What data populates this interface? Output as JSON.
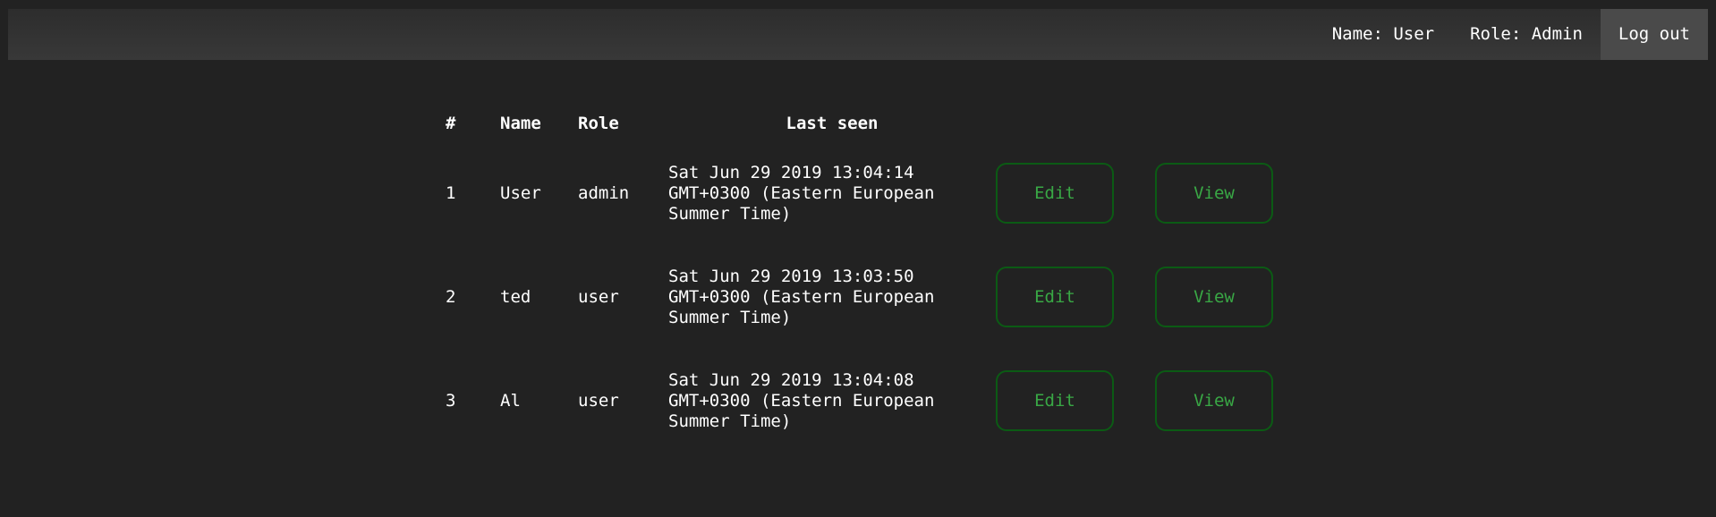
{
  "header": {
    "name_label": "Name: User",
    "role_label": "Role: Admin",
    "logout_label": "Log out"
  },
  "table": {
    "columns": [
      "#",
      "Name",
      "Role",
      "Last seen"
    ],
    "rows": [
      {
        "num": "1",
        "name": "User",
        "role": "admin",
        "last_seen": "Sat Jun 29 2019 13:04:14 GMT+0300 (Eastern European Summer Time)",
        "edit_label": "Edit",
        "view_label": "View"
      },
      {
        "num": "2",
        "name": "ted",
        "role": "user",
        "last_seen": "Sat Jun 29 2019 13:03:50 GMT+0300 (Eastern European Summer Time)",
        "edit_label": "Edit",
        "view_label": "View"
      },
      {
        "num": "3",
        "name": "Al",
        "role": "user",
        "last_seen": "Sat Jun 29 2019 13:04:08 GMT+0300 (Eastern European Summer Time)",
        "edit_label": "Edit",
        "view_label": "View"
      }
    ]
  },
  "colors": {
    "background": "#222222",
    "button_border": "#0b5b14",
    "button_text": "#39a845",
    "logout_bg": "#4a4a4a"
  }
}
